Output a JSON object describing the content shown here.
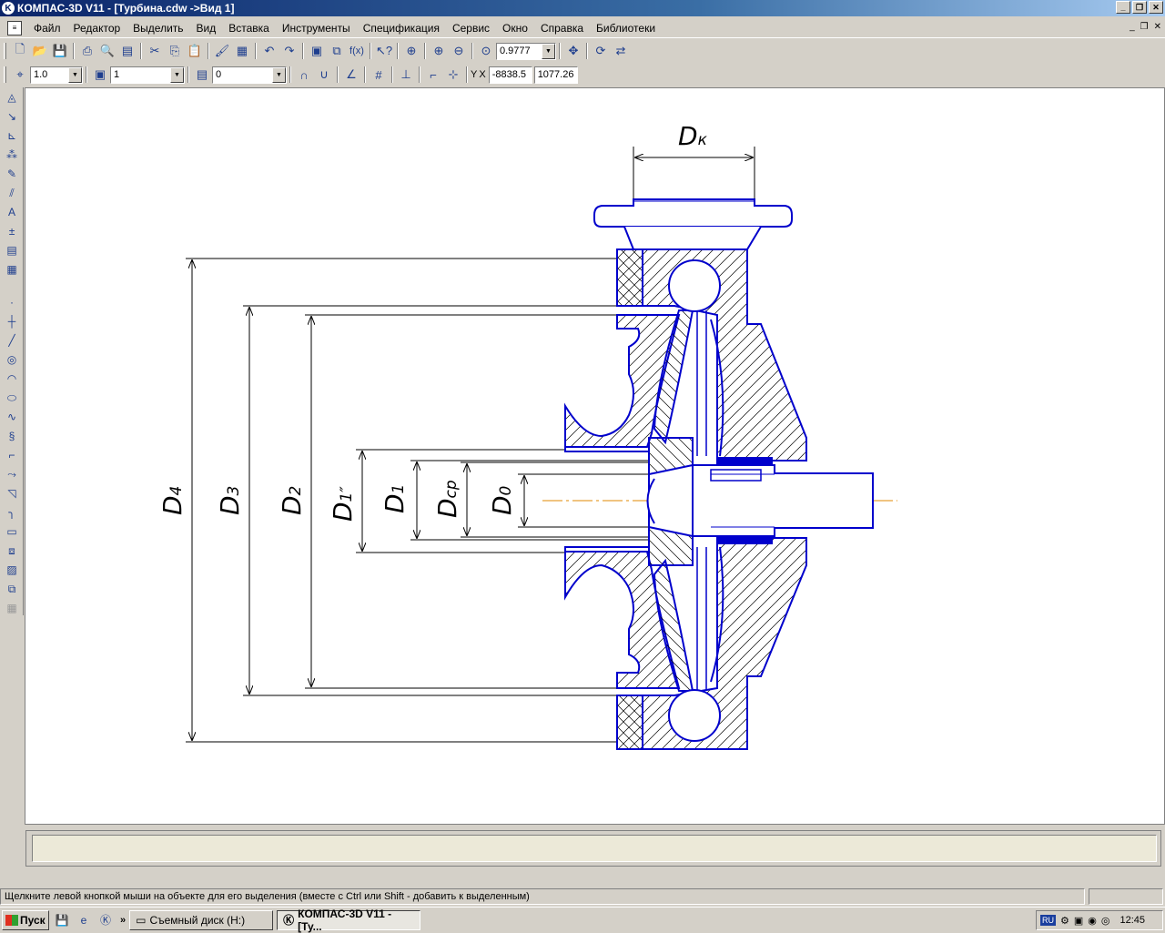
{
  "window": {
    "title": "КОМПАС-3D V11 - [Турбина.cdw ->Вид 1]",
    "app_icon": "K"
  },
  "menu": [
    "Файл",
    "Редактор",
    "Выделить",
    "Вид",
    "Вставка",
    "Инструменты",
    "Спецификация",
    "Сервис",
    "Окно",
    "Справка",
    "Библиотеки"
  ],
  "toolbar": {
    "zoom": "0.9777",
    "step": "1.0",
    "layer": "1",
    "style": "0",
    "coord_x_label": "X",
    "coord_y_label": "Y",
    "coord_x": "-8838.5",
    "coord_y": "1077.26"
  },
  "drawing": {
    "labels": {
      "dk": "D",
      "dk_sub": "к",
      "d4": "D",
      "d4_sub": "4",
      "d3": "D",
      "d3_sub": "3",
      "d2": "D",
      "d2_sub": "2",
      "d1pp": "D",
      "d1pp_sub": "1″",
      "d1": "D",
      "d1_sub": "1",
      "dcp": "D",
      "dcp_sub": "ср",
      "d0": "D",
      "d0_sub": "0"
    },
    "line_color": "#0000cc"
  },
  "status": {
    "hint": "Щелкните левой кнопкой мыши на объекте для его выделения (вместе с Ctrl или Shift - добавить к выделенным)"
  },
  "taskbar": {
    "start": "Пуск",
    "task1": "Съемный диск (H:)",
    "task2": "КОМПАС-3D V11 - [Ту...",
    "lang": "RU",
    "clock": "12:45",
    "more": "»"
  }
}
